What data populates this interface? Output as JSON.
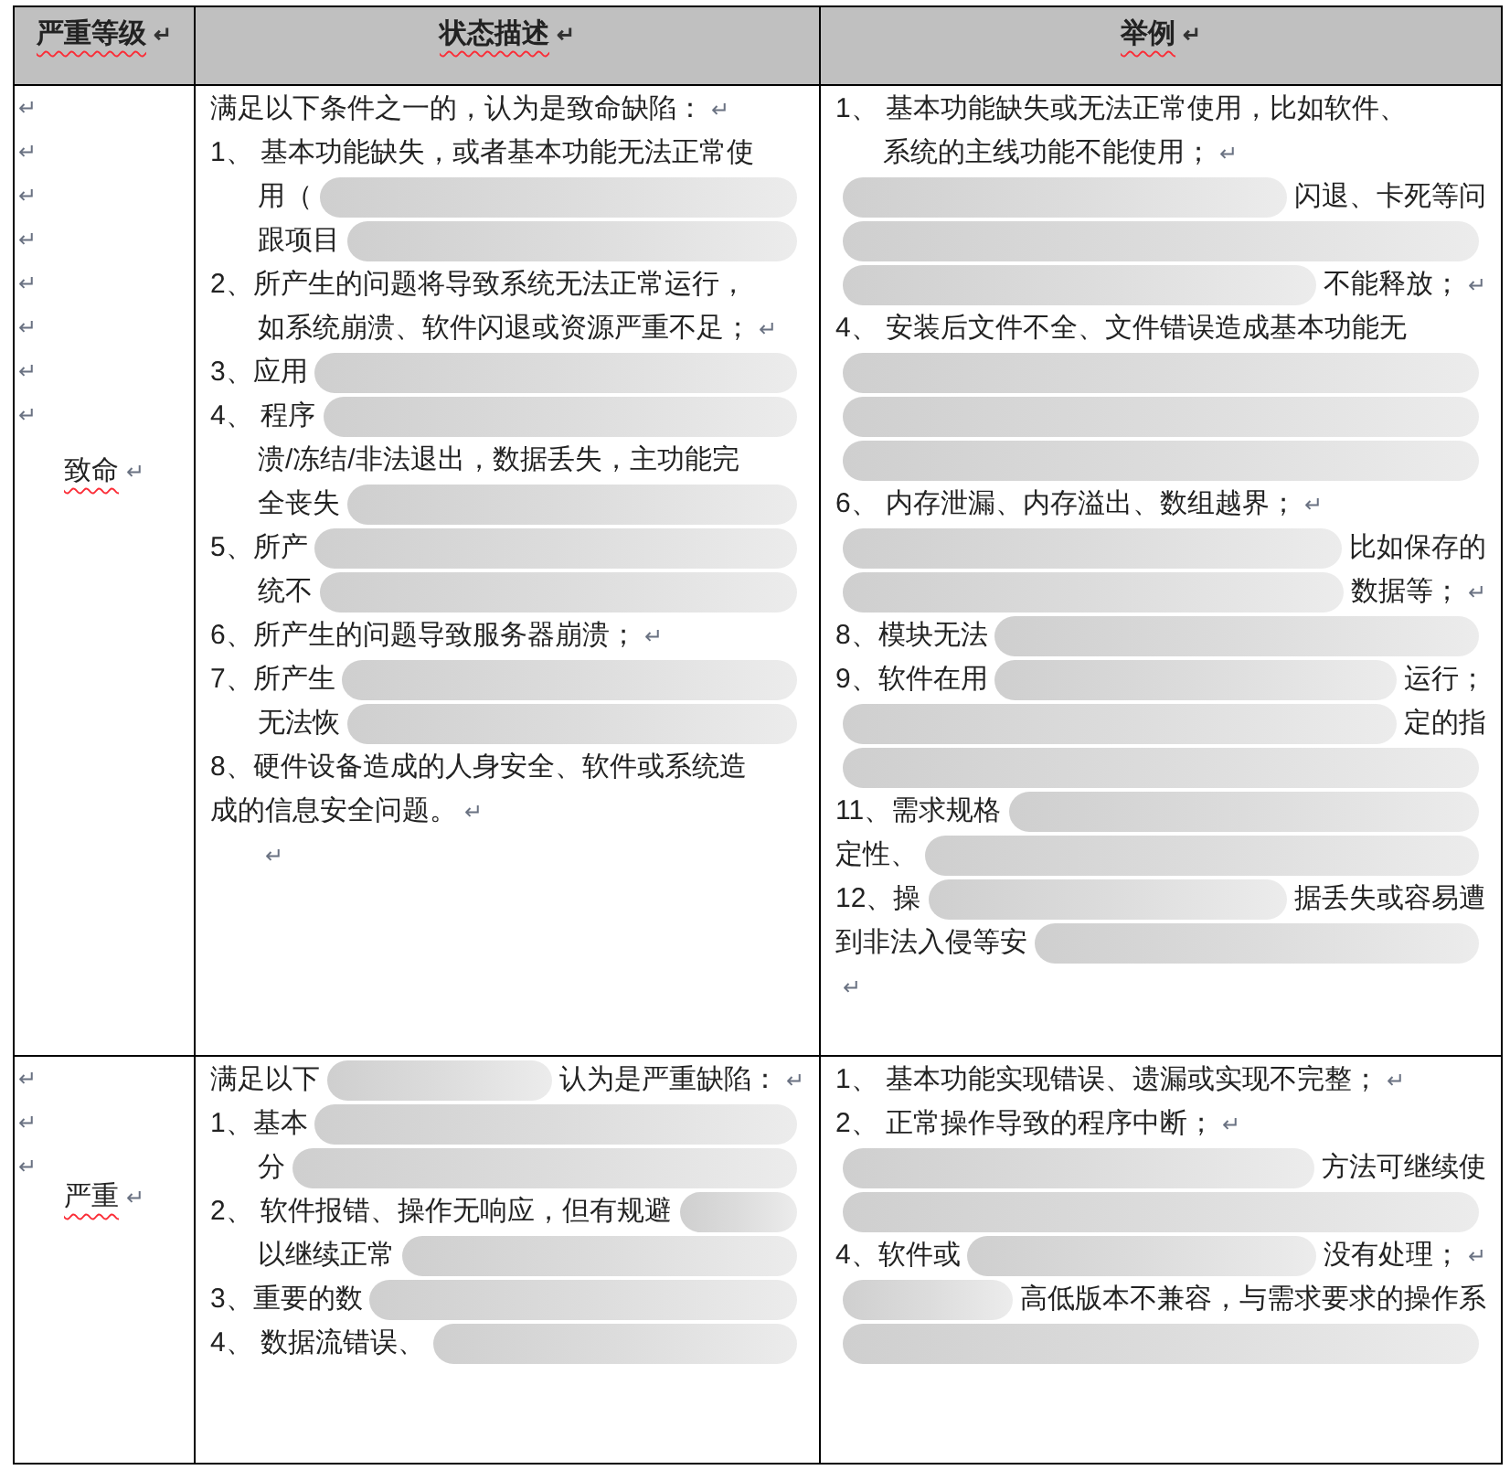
{
  "columns": [
    {
      "text": "严重等级",
      "mark": "↵"
    },
    {
      "text": "状态描述",
      "mark": "↵"
    },
    {
      "text": "举例",
      "mark": "↵"
    }
  ],
  "rows": [
    {
      "level": {
        "text": "致命",
        "mark": "↵"
      },
      "marks": [
        "↵",
        "↵",
        "↵",
        "↵",
        "↵",
        "↵",
        "↵",
        "↵"
      ],
      "description": [
        {
          "kind": "lead",
          "parts": [
            {
              "kind": "text",
              "text": "满足以下条件之一的，认为是致命缺陷："
            },
            {
              "kind": "mark",
              "text": "↵"
            }
          ]
        },
        {
          "kind": "lead",
          "parts": [
            {
              "kind": "text",
              "text": "1、 基本功能缺失，或者基本功能无法正常使"
            }
          ]
        },
        {
          "kind": "hanging",
          "parts": [
            {
              "kind": "text",
              "text": "用（"
            },
            {
              "kind": "blur"
            }
          ]
        },
        {
          "kind": "hanging",
          "parts": [
            {
              "kind": "text",
              "text": "跟项目"
            },
            {
              "kind": "blur"
            }
          ]
        },
        {
          "kind": "lead",
          "parts": [
            {
              "kind": "text",
              "text": "2、所产生的问题将导致系统无法正常运行，"
            }
          ]
        },
        {
          "kind": "hanging",
          "parts": [
            {
              "kind": "text",
              "text": "如系统崩溃、软件闪退或资源严重不足；"
            },
            {
              "kind": "mark",
              "text": "↵"
            }
          ]
        },
        {
          "kind": "lead",
          "parts": [
            {
              "kind": "text",
              "text": "3、应用"
            },
            {
              "kind": "blur"
            }
          ]
        },
        {
          "kind": "lead",
          "parts": [
            {
              "kind": "text",
              "text": "4、 程序"
            },
            {
              "kind": "blur"
            }
          ]
        },
        {
          "kind": "hanging",
          "parts": [
            {
              "kind": "text",
              "text": "溃/冻结/非法退出，数据丢失，主功能完"
            }
          ]
        },
        {
          "kind": "hanging",
          "parts": [
            {
              "kind": "text",
              "text": "全丧失"
            },
            {
              "kind": "blur"
            }
          ]
        },
        {
          "kind": "lead",
          "parts": [
            {
              "kind": "text",
              "text": "5、所产"
            },
            {
              "kind": "blur"
            }
          ]
        },
        {
          "kind": "hanging",
          "parts": [
            {
              "kind": "text",
              "text": "统不"
            },
            {
              "kind": "blur"
            }
          ]
        },
        {
          "kind": "lead",
          "parts": [
            {
              "kind": "text",
              "text": "6、所产生的问题导致服务器崩溃；"
            },
            {
              "kind": "mark",
              "text": "↵"
            }
          ]
        },
        {
          "kind": "lead",
          "parts": [
            {
              "kind": "text",
              "text": "7、所产生"
            },
            {
              "kind": "blur"
            }
          ]
        },
        {
          "kind": "hanging",
          "parts": [
            {
              "kind": "text",
              "text": "无法恢"
            },
            {
              "kind": "blur"
            }
          ]
        },
        {
          "kind": "lead",
          "parts": [
            {
              "kind": "text",
              "text": "8、硬件设备造成的人身安全、软件或系统造"
            }
          ]
        },
        {
          "kind": "lead",
          "parts": [
            {
              "kind": "text",
              "text": "成的信息安全问题。"
            },
            {
              "kind": "mark",
              "text": "↵"
            }
          ]
        },
        {
          "kind": "hanging",
          "parts": [
            {
              "kind": "mark",
              "text": "↵"
            }
          ]
        }
      ],
      "examples": [
        {
          "kind": "lead",
          "parts": [
            {
              "kind": "text",
              "text": "1、 基本功能缺失或无法正常使用，比如软件、"
            }
          ]
        },
        {
          "kind": "hanging",
          "parts": [
            {
              "kind": "text",
              "text": "系统的主线功能不能使用；"
            },
            {
              "kind": "mark",
              "text": "↵"
            }
          ]
        },
        {
          "kind": "lead",
          "parts": [
            {
              "kind": "blur"
            },
            {
              "kind": "text",
              "text": "闪退、卡死等问"
            }
          ]
        },
        {
          "kind": "lead",
          "parts": [
            {
              "kind": "blur"
            }
          ]
        },
        {
          "kind": "lead",
          "parts": [
            {
              "kind": "blur"
            },
            {
              "kind": "text",
              "text": "不能释放；"
            },
            {
              "kind": "mark",
              "text": "↵"
            }
          ]
        },
        {
          "kind": "lead",
          "parts": [
            {
              "kind": "text",
              "text": "4、 安装后文件不全、文件错误造成基本功能无"
            }
          ]
        },
        {
          "kind": "lead",
          "parts": [
            {
              "kind": "blur"
            }
          ]
        },
        {
          "kind": "lead",
          "parts": [
            {
              "kind": "blur"
            }
          ]
        },
        {
          "kind": "lead",
          "parts": [
            {
              "kind": "blur"
            }
          ]
        },
        {
          "kind": "lead",
          "parts": [
            {
              "kind": "text",
              "text": "6、 内存泄漏、内存溢出、数组越界；"
            },
            {
              "kind": "mark",
              "text": "↵"
            }
          ]
        },
        {
          "kind": "lead",
          "parts": [
            {
              "kind": "blur"
            },
            {
              "kind": "text",
              "text": "比如保存的"
            }
          ]
        },
        {
          "kind": "lead",
          "parts": [
            {
              "kind": "blur"
            },
            {
              "kind": "text",
              "text": "数据等；"
            },
            {
              "kind": "mark",
              "text": "↵"
            }
          ]
        },
        {
          "kind": "lead",
          "parts": [
            {
              "kind": "text",
              "text": "8、模块无法"
            },
            {
              "kind": "blur"
            }
          ]
        },
        {
          "kind": "lead",
          "parts": [
            {
              "kind": "text",
              "text": "9、软件在用"
            },
            {
              "kind": "blur"
            },
            {
              "kind": "text",
              "text": "运行；"
            }
          ]
        },
        {
          "kind": "lead",
          "parts": [
            {
              "kind": "blur"
            },
            {
              "kind": "text",
              "text": "定的指"
            }
          ]
        },
        {
          "kind": "lead",
          "parts": [
            {
              "kind": "blur"
            }
          ]
        },
        {
          "kind": "lead",
          "parts": [
            {
              "kind": "text",
              "text": "11、需求规格"
            },
            {
              "kind": "blur"
            }
          ]
        },
        {
          "kind": "lead",
          "parts": [
            {
              "kind": "text",
              "text": "定性、"
            },
            {
              "kind": "blur"
            }
          ]
        },
        {
          "kind": "lead",
          "parts": [
            {
              "kind": "text",
              "text": "12、操"
            },
            {
              "kind": "blur"
            },
            {
              "kind": "text",
              "text": "据丢失或容易遭"
            }
          ]
        },
        {
          "kind": "lead",
          "parts": [
            {
              "kind": "text",
              "text": "到非法入侵等安"
            },
            {
              "kind": "blur"
            }
          ]
        },
        {
          "kind": "lead",
          "parts": [
            {
              "kind": "mark",
              "text": "↵"
            }
          ]
        }
      ]
    },
    {
      "level": {
        "text": "严重",
        "mark": "↵"
      },
      "marks": [
        "↵",
        "↵",
        "↵"
      ],
      "description": [
        {
          "kind": "lead",
          "parts": [
            {
              "kind": "text",
              "text": "满足以下"
            },
            {
              "kind": "blur"
            },
            {
              "kind": "text",
              "text": "认为是严重缺陷："
            },
            {
              "kind": "mark",
              "text": "↵"
            }
          ]
        },
        {
          "kind": "lead",
          "parts": [
            {
              "kind": "text",
              "text": "1、基本"
            },
            {
              "kind": "blur"
            }
          ]
        },
        {
          "kind": "hanging",
          "parts": [
            {
              "kind": "text",
              "text": "分"
            },
            {
              "kind": "blur"
            }
          ]
        },
        {
          "kind": "lead",
          "parts": [
            {
              "kind": "text",
              "text": "2、 软件报错、操作无响应，但有规避"
            },
            {
              "kind": "blur"
            }
          ]
        },
        {
          "kind": "hanging",
          "parts": [
            {
              "kind": "text",
              "text": "以继续正常"
            },
            {
              "kind": "blur"
            }
          ]
        },
        {
          "kind": "lead",
          "parts": [
            {
              "kind": "text",
              "text": "3、重要的数"
            },
            {
              "kind": "blur"
            }
          ]
        },
        {
          "kind": "lead",
          "parts": [
            {
              "kind": "text",
              "text": "4、 数据流错误、"
            },
            {
              "kind": "blur"
            }
          ]
        }
      ],
      "examples": [
        {
          "kind": "lead",
          "parts": [
            {
              "kind": "text",
              "text": "1、 基本功能实现错误、遗漏或实现不完整；"
            },
            {
              "kind": "mark",
              "text": "↵"
            }
          ]
        },
        {
          "kind": "lead",
          "parts": [
            {
              "kind": "text",
              "text": "2、 正常操作导致的程序中断；"
            },
            {
              "kind": "mark",
              "text": "↵"
            }
          ]
        },
        {
          "kind": "lead",
          "parts": [
            {
              "kind": "blur"
            },
            {
              "kind": "text",
              "text": "方法可继续使"
            }
          ]
        },
        {
          "kind": "lead",
          "parts": [
            {
              "kind": "blur"
            }
          ]
        },
        {
          "kind": "lead",
          "parts": [
            {
              "kind": "text",
              "text": "4、软件或"
            },
            {
              "kind": "blur"
            },
            {
              "kind": "text",
              "text": "没有处理；"
            },
            {
              "kind": "mark",
              "text": "↵"
            }
          ]
        },
        {
          "kind": "lead",
          "parts": [
            {
              "kind": "blur"
            },
            {
              "kind": "text",
              "text": "高低版本不兼容，与需求要求的操作系"
            }
          ]
        },
        {
          "kind": "lead",
          "parts": [
            {
              "kind": "blur"
            }
          ]
        }
      ]
    }
  ]
}
